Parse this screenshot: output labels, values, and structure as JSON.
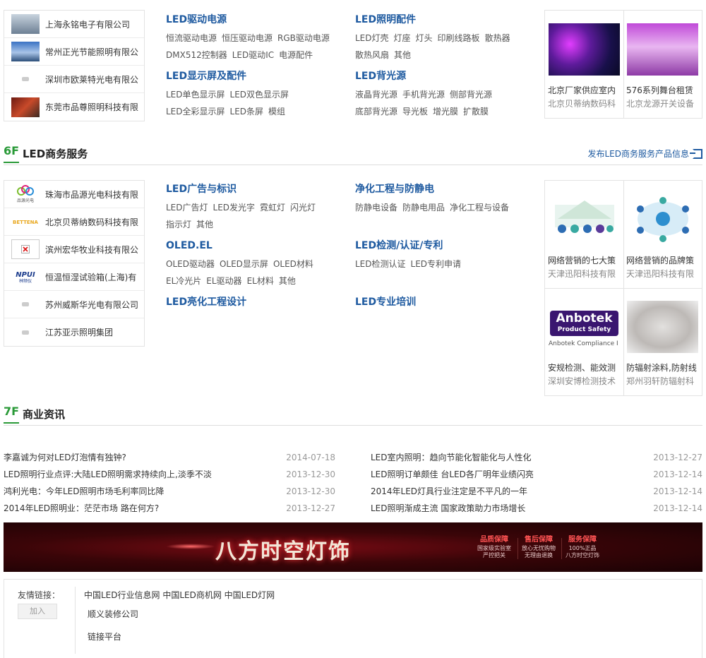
{
  "section_top": {
    "companies": [
      {
        "name": "上海永铭电子有限公司",
        "logo": "photo"
      },
      {
        "name": "常州正光节能照明有限公",
        "logo": "photo"
      },
      {
        "name": "深圳市欧莱特光电有限公",
        "logo": "placeholder"
      },
      {
        "name": "东莞市品尊照明科技有限",
        "logo": "photo"
      }
    ],
    "categories": [
      {
        "title": "LED驱动电源",
        "links": [
          "恒流驱动电源",
          "恒压驱动电源",
          "RGB驱动电源",
          "DMX512控制器",
          "LED驱动IC",
          "电源配件"
        ]
      },
      {
        "title": "LED照明配件",
        "links": [
          "LED灯壳",
          "灯座",
          "灯头",
          "印刷线路板",
          "散热器",
          "散热风扇",
          "其他"
        ]
      },
      {
        "title": "LED显示屏及配件",
        "links": [
          "LED单色显示屏",
          "LED双色显示屏",
          "LED全彩显示屏",
          "LED条屏",
          "模组"
        ]
      },
      {
        "title": "LED背光源",
        "links": [
          "液晶背光源",
          "手机背光源",
          "侧部背光源",
          "底部背光源",
          "导光板",
          "增光膜",
          "扩散膜"
        ]
      }
    ],
    "products": [
      {
        "title": "北京厂家供应室内",
        "company": "北京贝蒂纳数码科"
      },
      {
        "title": "576系列舞台租赁",
        "company": "北京龙源开关设备"
      }
    ]
  },
  "floor6": {
    "num": "6F",
    "title": "LED商务服务",
    "post_link": "发布LED商务服务产品信息",
    "companies": [
      {
        "name": "珠海市品源光电科技有限",
        "logo": "品源光电"
      },
      {
        "name": "北京贝蒂纳数码科技有限",
        "logo": "BETTENA"
      },
      {
        "name": "滨州宏华牧业科技有限公",
        "logo": "broken"
      },
      {
        "name": "恒温恒湿试验箱(上海)有",
        "logo": "NPUI"
      },
      {
        "name": "苏州威斯华光电有限公司",
        "logo": "placeholder"
      },
      {
        "name": "江苏亚示照明集团",
        "logo": "placeholder"
      }
    ],
    "categories": [
      {
        "title": "LED广告与标识",
        "links": [
          "LED广告灯",
          "LED发光字",
          "霓虹灯",
          "闪光灯",
          "指示灯",
          "其他"
        ]
      },
      {
        "title": "净化工程与防静电",
        "links": [
          "防静电设备",
          "防静电用品",
          "净化工程与设备"
        ]
      },
      {
        "title": "OLED.EL",
        "links": [
          "OLED驱动器",
          "OLED显示屏",
          "OLED材料",
          "EL冷光片",
          "EL驱动器",
          "EL材料",
          "其他"
        ]
      },
      {
        "title": "LED检测/认证/专利",
        "links": [
          "LED检测认证",
          "LED专利申请"
        ]
      },
      {
        "title": "LED亮化工程设计",
        "links": []
      },
      {
        "title": "LED专业培训",
        "links": []
      }
    ],
    "products": [
      {
        "title": "网络营销的七大策",
        "company": "天津迅阳科技有限"
      },
      {
        "title": "网络营销的品牌策",
        "company": "天津迅阳科技有限"
      },
      {
        "title": "安规检测、能效测",
        "company": "深圳安博检测技术"
      },
      {
        "title": "防辐射涂料,防射线",
        "company": "郑州羽轩防辐射科"
      }
    ],
    "anbotek": {
      "brand": "Anbotek",
      "tagline": "Product Safety",
      "caption": "Anbotek Compliance I"
    }
  },
  "floor7": {
    "num": "7F",
    "title": "商业资讯",
    "news_left": [
      {
        "title": "李嘉诚为何对LED灯泡情有独钟?",
        "date": "2014-07-18"
      },
      {
        "title": "LED照明行业点评:大陆LED照明需求持续向上,淡季不淡",
        "date": "2013-12-30"
      },
      {
        "title": "鸿利光电：今年LED照明市场毛利率同比降",
        "date": "2013-12-30"
      },
      {
        "title": "2014年LED照明业：茫茫市场 路在何方?",
        "date": "2013-12-27"
      }
    ],
    "news_right": [
      {
        "title": "LED室内照明：趋向节能化智能化与人性化",
        "date": "2013-12-27"
      },
      {
        "title": "LED照明订单颇佳 台LED各厂明年业绩闪亮",
        "date": "2013-12-14"
      },
      {
        "title": "2014年LED灯具行业注定是不平凡的一年",
        "date": "2013-12-14"
      },
      {
        "title": "LED照明渐成主流 国家政策助力市场增长",
        "date": "2013-12-14"
      }
    ]
  },
  "banner": {
    "title": "八方时空灯饰",
    "tags": [
      {
        "head": "品质保障",
        "l1": "国家级实验室",
        "l2": "严控把关"
      },
      {
        "head": "售后保障",
        "l1": "放心无忧购物",
        "l2": "无理由退换"
      },
      {
        "head": "服务保障",
        "l1": "100%正品",
        "l2": "八方时空灯饰"
      }
    ]
  },
  "friend_links": {
    "label": "友情链接：",
    "join": "加入",
    "line1": "中国LED行业信息网 中国LED商机网 中国LED灯网",
    "line2": "顺义装修公司",
    "line3": "链接平台"
  }
}
